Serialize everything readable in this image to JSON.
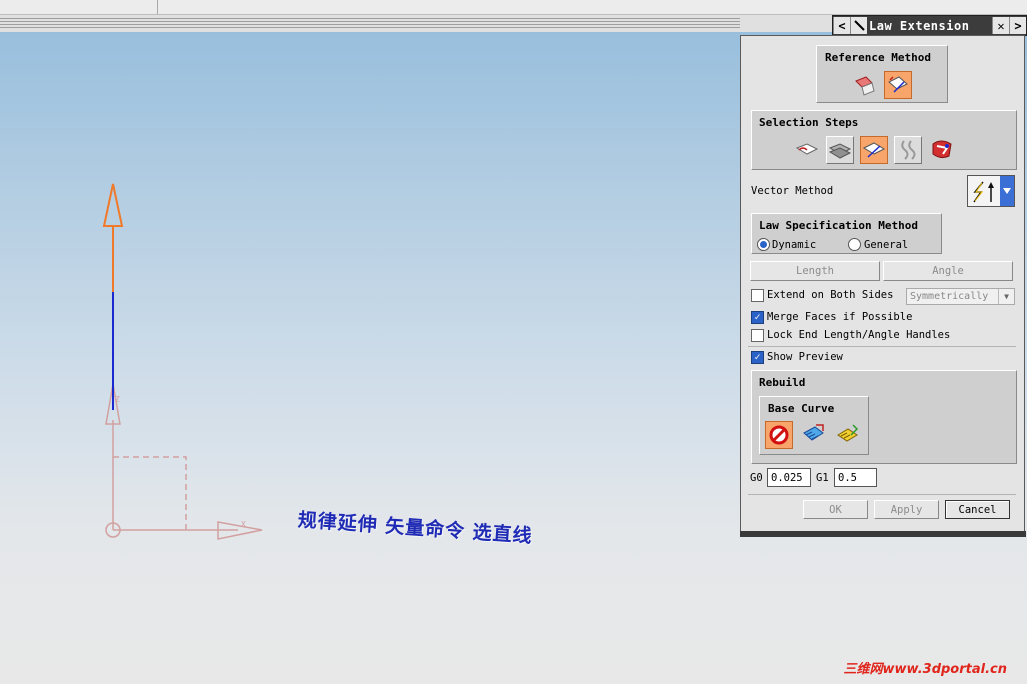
{
  "window": {
    "title": "Law Extension",
    "nav_prev": "<",
    "nav_next": ">",
    "close": "✕"
  },
  "reference_method": {
    "title": "Reference Method",
    "options": [
      "face-reference",
      "vector-reference"
    ],
    "selected": 1
  },
  "selection_steps": {
    "title": "Selection Steps",
    "steps": [
      "base-curve",
      "face",
      "reference-vector",
      "length-law",
      "angle-law"
    ],
    "selected": 2
  },
  "vector_method": {
    "label": "Vector Method",
    "icon": "vector-method-icon"
  },
  "law_spec": {
    "title": "Law Specification Method",
    "options": [
      "Dynamic",
      "General"
    ],
    "selected": "Dynamic"
  },
  "law_buttons": {
    "length": "Length",
    "angle": "Angle"
  },
  "options": {
    "extend_both_sides": {
      "label": "Extend on Both Sides",
      "checked": false
    },
    "symmetric_select": "Symmetrically",
    "merge_faces": {
      "label": "Merge Faces if Possible",
      "checked": true
    },
    "lock_end": {
      "label": "Lock End Length/Angle Handles",
      "checked": false
    },
    "show_preview": {
      "label": "Show Preview",
      "checked": true
    }
  },
  "rebuild": {
    "title": "Rebuild",
    "base_curve_title": "Base Curve"
  },
  "continuity": {
    "g0_label": "G0",
    "g0_value": "0.025",
    "g1_label": "G1",
    "g1_value": "0.5"
  },
  "footer": {
    "ok": "OK",
    "apply": "Apply",
    "cancel": "Cancel"
  },
  "canvas": {
    "annotation": "规律延伸 矢量命令 选直线",
    "axis_x": "X",
    "axis_z": "Z",
    "watermark": "三维网www.3dportal.cn"
  },
  "colors": {
    "accent_orange": "#f7a56b",
    "selection_blue": "#2a62c7",
    "annotation_blue": "#1f2bb5",
    "watermark_red": "#e0261c"
  }
}
